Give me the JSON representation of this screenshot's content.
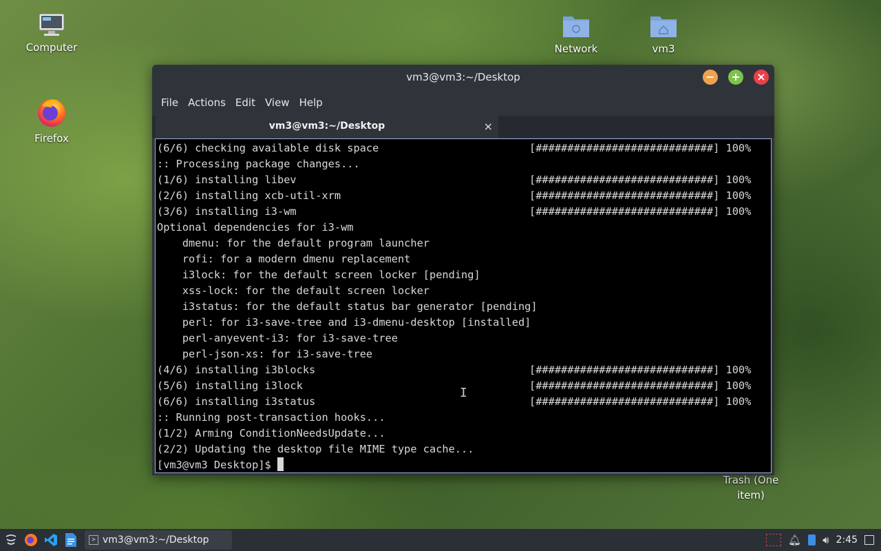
{
  "desktop": {
    "icons": [
      {
        "label": "Computer"
      },
      {
        "label": "Firefox"
      },
      {
        "label": "Network"
      },
      {
        "label": "vm3"
      },
      {
        "label": "Trash (One item)"
      }
    ]
  },
  "window": {
    "title": "vm3@vm3:~/Desktop",
    "menu": [
      "File",
      "Actions",
      "Edit",
      "View",
      "Help"
    ],
    "tab_label": "vm3@vm3:~/Desktop",
    "tab_close": "×"
  },
  "terminal": {
    "lines": [
      {
        "text": "(6/6) checking available disk space",
        "progress": "[############################] 100%"
      },
      {
        "text": ":: Processing package changes...",
        "progress": ""
      },
      {
        "text": "(1/6) installing libev",
        "progress": "[############################] 100%"
      },
      {
        "text": "(2/6) installing xcb-util-xrm",
        "progress": "[############################] 100%"
      },
      {
        "text": "(3/6) installing i3-wm",
        "progress": "[############################] 100%"
      },
      {
        "text": "Optional dependencies for i3-wm",
        "progress": ""
      },
      {
        "text": "    dmenu: for the default program launcher",
        "progress": ""
      },
      {
        "text": "    rofi: for a modern dmenu replacement",
        "progress": ""
      },
      {
        "text": "    i3lock: for the default screen locker [pending]",
        "progress": ""
      },
      {
        "text": "    xss-lock: for the default screen locker",
        "progress": ""
      },
      {
        "text": "    i3status: for the default status bar generator [pending]",
        "progress": ""
      },
      {
        "text": "    perl: for i3-save-tree and i3-dmenu-desktop [installed]",
        "progress": ""
      },
      {
        "text": "    perl-anyevent-i3: for i3-save-tree",
        "progress": ""
      },
      {
        "text": "    perl-json-xs: for i3-save-tree",
        "progress": ""
      },
      {
        "text": "(4/6) installing i3blocks",
        "progress": "[############################] 100%"
      },
      {
        "text": "(5/6) installing i3lock",
        "progress": "[############################] 100%"
      },
      {
        "text": "(6/6) installing i3status",
        "progress": "[############################] 100%"
      },
      {
        "text": ":: Running post-transaction hooks...",
        "progress": ""
      },
      {
        "text": "(1/2) Arming ConditionNeedsUpdate...",
        "progress": ""
      },
      {
        "text": "(2/2) Updating the desktop file MIME type cache...",
        "progress": ""
      }
    ],
    "prompt": "[vm3@vm3 Desktop]$ "
  },
  "taskbar": {
    "task_label": "vm3@vm3:~/Desktop",
    "clock": "2:45"
  },
  "colors": {
    "window_bg": "#2f343b",
    "terminal_bg": "#000000",
    "minimize": "#f0a24e",
    "maximize": "#7cc34b",
    "close": "#e8414a"
  }
}
